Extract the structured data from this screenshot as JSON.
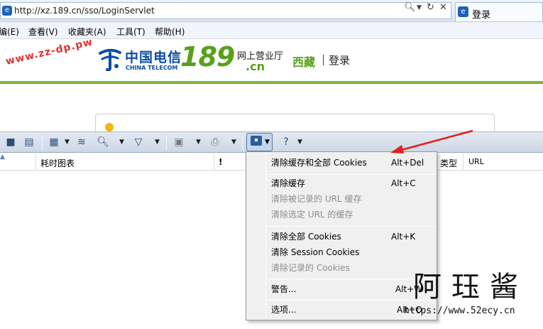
{
  "browser": {
    "url": "http://xz.189.cn/sso/LoginServlet",
    "tab_title": "登录"
  },
  "menu": {
    "items": [
      "编(E)",
      "查看(V)",
      "收藏夹(A)",
      "工具(T)",
      "帮助(H)"
    ]
  },
  "page": {
    "watermark": "www.zz-dp.pw",
    "brand_cn": "中国电信",
    "brand_en": "CHINA TELECOM",
    "brand_number": "189",
    "brand_subtitle": "网上营业厅",
    "brand_domain": ".cn",
    "region": "西藏",
    "login_link": "登录"
  },
  "devtools": {
    "columns": [
      "耗时图表",
      "!",
      "类型",
      "URL"
    ]
  },
  "cache_menu": {
    "items": [
      {
        "label": "清除缓存和全部 Cookies",
        "shortcut": "Alt+Del",
        "enabled": true
      },
      {
        "label": "清除缓存",
        "shortcut": "Alt+C",
        "enabled": true
      },
      {
        "label": "清除被记录的 URL 缓存",
        "shortcut": "",
        "enabled": false
      },
      {
        "label": "清除选定 URL 的缓存",
        "shortcut": "",
        "enabled": false
      },
      {
        "label": "清除全部 Cookies",
        "shortcut": "Alt+K",
        "enabled": true
      },
      {
        "label": "清除 Session Cookies",
        "shortcut": "",
        "enabled": true
      },
      {
        "label": "清除记录的 Cookies",
        "shortcut": "",
        "enabled": false
      },
      {
        "label": "警告...",
        "shortcut": "Alt+W",
        "enabled": true
      },
      {
        "label": "选项...",
        "shortcut": "Alt+O",
        "enabled": true
      }
    ]
  },
  "overlay": {
    "author_cn": "阿珏酱",
    "author_url": "https://www.52ecy.cn"
  },
  "colors": {
    "telecom_blue": "#0b4ca7",
    "telecom_green": "#57a11a",
    "arrow_red": "#e0201b"
  }
}
